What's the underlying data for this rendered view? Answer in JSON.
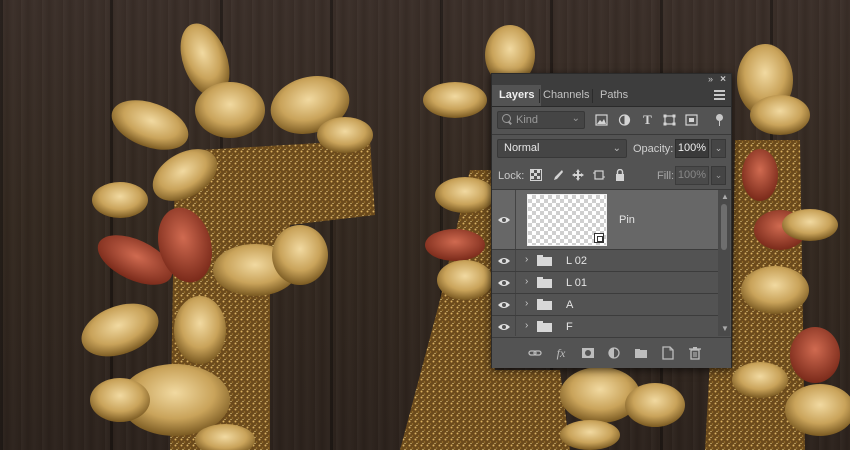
{
  "panel": {
    "tabs": [
      {
        "label": "Layers",
        "active": true
      },
      {
        "label": "Channels",
        "active": false
      },
      {
        "label": "Paths",
        "active": false
      }
    ],
    "titlebar": {
      "collapse_icon": "double-chevron-right-icon",
      "close_icon": "close-icon"
    },
    "filter": {
      "kind_label": "Kind",
      "icons": [
        "image-filter-icon",
        "adjustment-filter-icon",
        "type-filter-icon",
        "shape-filter-icon",
        "smart-object-filter-icon"
      ]
    },
    "blend": {
      "mode": "Normal",
      "opacity_label": "Opacity:",
      "opacity_value": "100%"
    },
    "lock": {
      "label": "Lock:",
      "fill_label": "Fill:",
      "fill_value": "100%",
      "icons": [
        "lock-transparent-pixels-icon",
        "lock-image-pixels-icon",
        "lock-position-icon",
        "lock-artboard-icon",
        "lock-all-icon"
      ]
    },
    "layers": [
      {
        "name": "Pin",
        "type": "smart-object",
        "visible": true,
        "selected": true
      },
      {
        "name": "L 02",
        "type": "group",
        "visible": true,
        "selected": false
      },
      {
        "name": "L 01",
        "type": "group",
        "visible": true,
        "selected": false
      },
      {
        "name": "A",
        "type": "group",
        "visible": true,
        "selected": false
      },
      {
        "name": "F",
        "type": "group",
        "visible": true,
        "selected": false
      }
    ],
    "bottom_icons": [
      "link-layers-icon",
      "fx-icon",
      "add-mask-icon",
      "adjustment-layer-icon",
      "new-group-icon",
      "new-layer-icon",
      "trash-icon"
    ],
    "colors": {
      "panel_bg": "#535353",
      "tab_bar": "#3d3d3d",
      "selected_row": "#676767"
    }
  }
}
